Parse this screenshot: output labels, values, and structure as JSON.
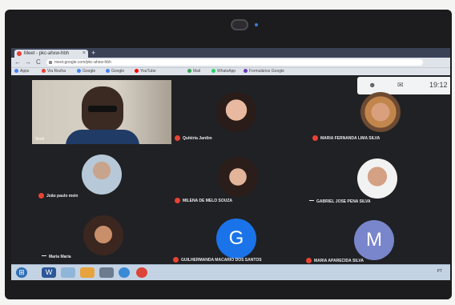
{
  "browser": {
    "tab_title": "Meet - pkc-ahxw-hbh",
    "tab_close": "×",
    "new_tab": "+",
    "nav": {
      "back": "←",
      "forward": "→",
      "reload": "C"
    },
    "url": "meet.google.com/pkc-ahxw-hbh",
    "bookmarks": [
      {
        "label": "Apps",
        "color": "#4285f4"
      },
      {
        "label": "Via Rezha",
        "color": "#e94235"
      },
      {
        "label": "Google",
        "color": "#4285f4"
      },
      {
        "label": "Google",
        "color": "#4285f4"
      },
      {
        "label": "YouTube",
        "color": "#ff0000"
      },
      {
        "label": "Mail",
        "color": "#34a853"
      },
      {
        "label": "WhatsApp",
        "color": "#25d366"
      },
      {
        "label": "Formulários Google",
        "color": "#673ab7"
      }
    ]
  },
  "meet": {
    "clock": "19:12",
    "self_view": {
      "name": "Você"
    },
    "participants": [
      {
        "name": "Quitéria Jardim",
        "type": "photo",
        "mic": "muted"
      },
      {
        "name": "MARIA FERNANDA LIMA SILVA",
        "type": "photo",
        "mic": "muted"
      },
      {
        "name": "João paulo mein",
        "type": "photo",
        "mic": "muted"
      },
      {
        "name": "MILENA DE MELO SOUZA",
        "type": "photo",
        "mic": "muted"
      },
      {
        "name": "GABRIEL JOSE PENA SILVA",
        "type": "photo",
        "mic": "active"
      },
      {
        "name": "Maria Maria",
        "type": "photo",
        "mic": "active"
      },
      {
        "name": "GUILHERMANDA MACARIO DOS SANTOS",
        "type": "letter",
        "letter": "G",
        "color": "#1a73e8",
        "mic": "muted"
      },
      {
        "name": "MARIA APARECIDA SILVA",
        "type": "letter",
        "letter": "M",
        "color": "#7986cb",
        "mic": "muted"
      }
    ]
  },
  "taskbar": {
    "start_label": "⊞",
    "tray_text": "PT"
  },
  "colors": {
    "meet_bg": "#202124",
    "mic_muted": "#e94235"
  }
}
